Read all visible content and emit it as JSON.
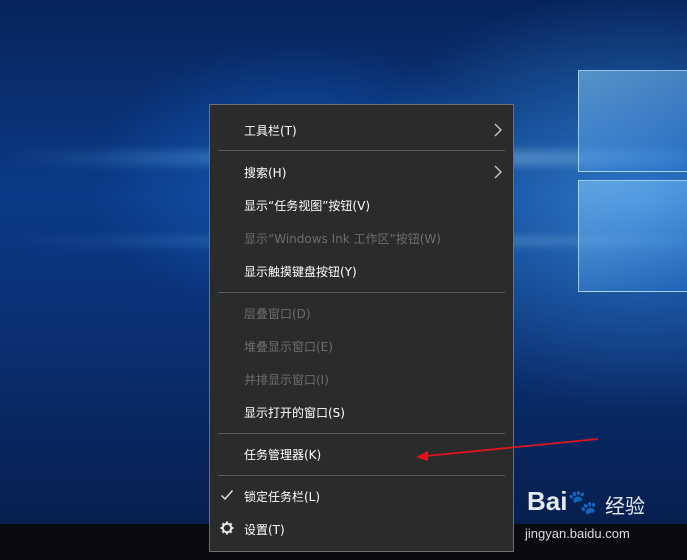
{
  "menu": {
    "items": [
      {
        "label": "工具栏(T)",
        "disabled": false,
        "submenu": true
      },
      {
        "label": "搜索(H)",
        "disabled": false,
        "submenu": true
      },
      {
        "label": "显示“任务视图”按钮(V)",
        "disabled": false
      },
      {
        "label": "显示“Windows Ink 工作区”按钮(W)",
        "disabled": true
      },
      {
        "label": "显示触摸键盘按钮(Y)",
        "disabled": false
      },
      {
        "label": "层叠窗口(D)",
        "disabled": true
      },
      {
        "label": "堆叠显示窗口(E)",
        "disabled": true
      },
      {
        "label": "并排显示窗口(I)",
        "disabled": true
      },
      {
        "label": "显示打开的窗口(S)",
        "disabled": false
      },
      {
        "label": "任务管理器(K)",
        "disabled": false
      },
      {
        "label": "锁定任务栏(L)",
        "disabled": false,
        "checked": true,
        "icon": "checkmark-icon"
      },
      {
        "label": "设置(T)",
        "disabled": false,
        "icon": "gear-icon"
      }
    ]
  },
  "annotation": {
    "color": "#e0141e",
    "points_to": "任务管理器(K)"
  },
  "watermark": {
    "logo": "Bai",
    "logo_suffix": "经验",
    "url": "jingyan.baidu.com"
  },
  "colors": {
    "menu_bg": "#2b2b2b",
    "menu_border": "#6f6f6f",
    "text": "#ffffff",
    "disabled_text": "#6d6d6d",
    "separator": "#5a5a5a"
  }
}
